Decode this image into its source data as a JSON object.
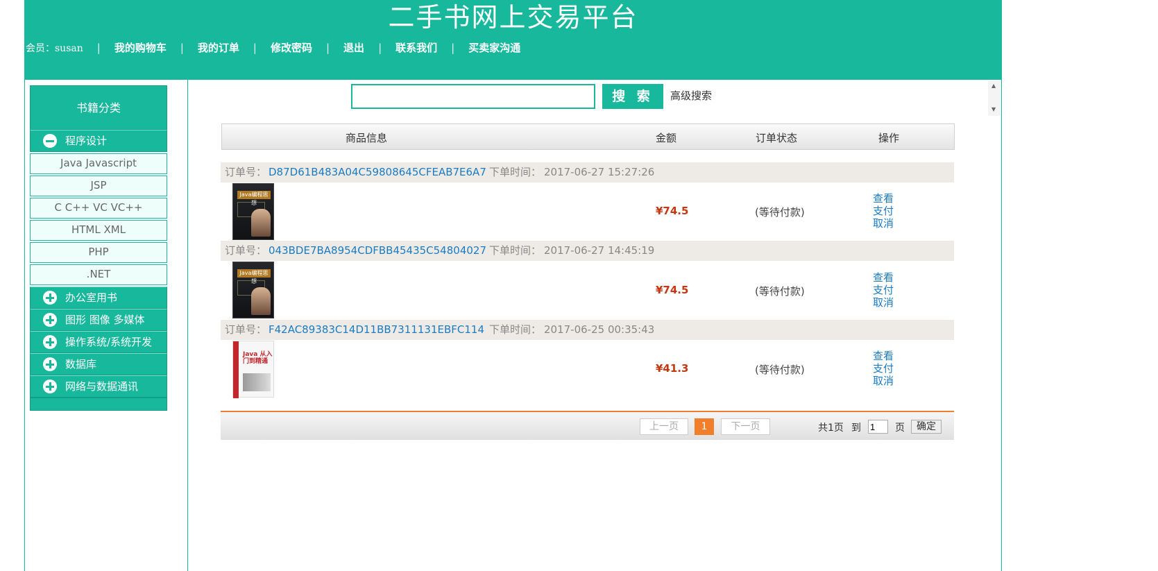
{
  "header": {
    "title": "二手书网上交易平台",
    "member_label": "会员：susan",
    "nav": [
      "我的购物车",
      "我的订单",
      "修改密码",
      "退出",
      "联系我们",
      "买卖家沟通"
    ]
  },
  "sidebar": {
    "title": "书籍分类",
    "categories": [
      {
        "label": "程序设计",
        "expanded": true,
        "items": [
          "Java Javascript",
          "JSP",
          "C C++ VC VC++",
          "HTML XML",
          "PHP",
          ".NET"
        ]
      },
      {
        "label": "办公室用书",
        "expanded": false
      },
      {
        "label": "图形 图像 多媒体",
        "expanded": false
      },
      {
        "label": "操作系统/系统开发",
        "expanded": false
      },
      {
        "label": "数据库",
        "expanded": false
      },
      {
        "label": "网络与数据通讯",
        "expanded": false
      }
    ]
  },
  "search": {
    "value": "",
    "button_label": "搜 索",
    "advanced_label": "高级搜索"
  },
  "table": {
    "columns": [
      "商品信息",
      "金额",
      "订单状态",
      "操作"
    ]
  },
  "orders": [
    {
      "order_label": "订单号：",
      "order_id": "D87D61B483A04C59808645CFEAB7E6A7",
      "time_label": "下单时间：",
      "time": "2017-06-27 15:27:26",
      "price": "¥74.5",
      "status": "(等待付款)",
      "book_cover": "Java编程思想",
      "actions": [
        "查看",
        "支付",
        "取消"
      ]
    },
    {
      "order_label": "订单号：",
      "order_id": "043BDE7BA8954CDFBB45435C54804027",
      "time_label": "下单时间：",
      "time": "2017-06-27 14:45:19",
      "price": "¥74.5",
      "status": "(等待付款)",
      "book_cover": "Java编程思想",
      "actions": [
        "查看",
        "支付",
        "取消"
      ]
    },
    {
      "order_label": "订单号：",
      "order_id": "F42AC89383C14D11BB7311131EBFC114",
      "time_label": "下单时间：",
      "time": "2017-06-25 00:35:43",
      "price": "¥41.3",
      "status": "(等待付款)",
      "book_cover": "Java 从入门到精通",
      "actions": [
        "查看",
        "支付",
        "取消"
      ]
    }
  ],
  "pager": {
    "prev_label": "上一页",
    "current_page": "1",
    "next_label": "下一页",
    "total_label": "共1页",
    "goto_label": "到",
    "page_input": "1",
    "page_unit": "页",
    "confirm_label": "确定"
  },
  "colors": {
    "brand": "#17b89c",
    "price": "#c53711",
    "link": "#1a7cc3",
    "pager_accent": "#f07e2a"
  }
}
